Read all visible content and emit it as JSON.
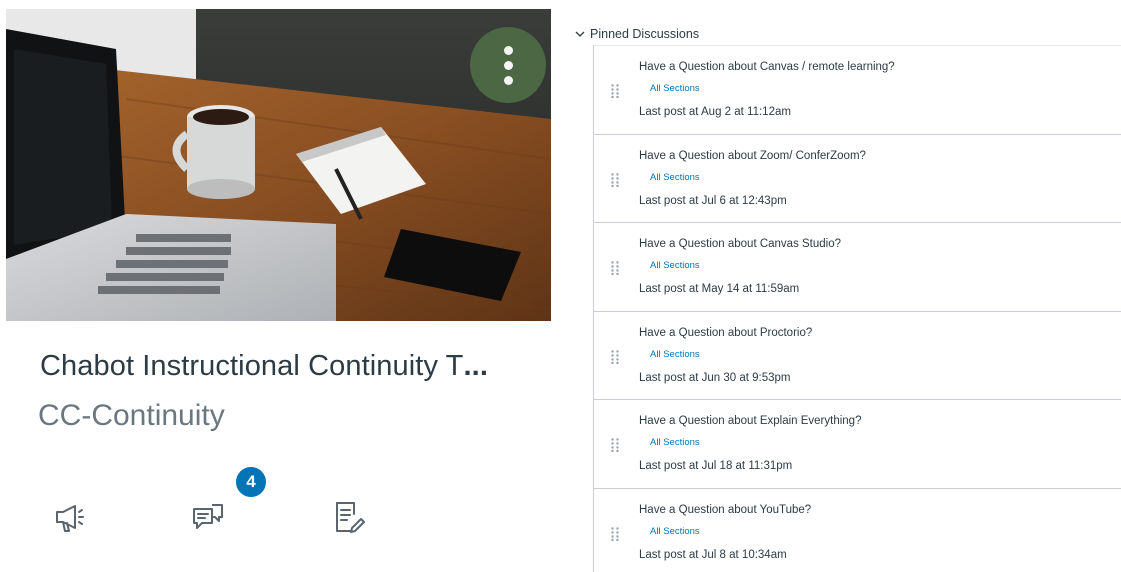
{
  "course_card": {
    "title": "Chabot Instructional Continuity T",
    "title_ellipsis": "...",
    "code": "CC-Continuity",
    "unread_discussions": "4"
  },
  "pinned": {
    "header": "Pinned Discussions",
    "items": [
      {
        "title": "Have a Question about Canvas / remote learning?",
        "section": "All Sections",
        "last_post": "Last post at Aug 2 at 11:12am"
      },
      {
        "title": "Have a Question about Zoom/ ConferZoom?",
        "section": "All Sections",
        "last_post": "Last post at Jul 6 at 12:43pm"
      },
      {
        "title": "Have a Question about Canvas Studio?",
        "section": "All Sections",
        "last_post": "Last post at May 14 at 11:59am"
      },
      {
        "title": "Have a Question about Proctorio?",
        "section": "All Sections",
        "last_post": "Last post at Jun 30 at 9:53pm"
      },
      {
        "title": "Have a Question about Explain Everything?",
        "section": "All Sections",
        "last_post": "Last post at Jul 18 at 11:31pm"
      },
      {
        "title": "Have a Question about YouTube?",
        "section": "All Sections",
        "last_post": "Last post at Jul 8 at 10:34am"
      }
    ]
  },
  "icons": {
    "announcements": "megaphone-icon",
    "discussions": "discussion-icon",
    "assignments": "assignment-icon",
    "options": "kebab-menu-icon",
    "collapse": "chevron-down-icon",
    "drag": "drag-handle-icon"
  },
  "colors": {
    "link": "#0374b5",
    "badge": "#0374b5",
    "options_button": "#4d6a44",
    "text": "#2d3b45",
    "muted": "#6b7780"
  }
}
